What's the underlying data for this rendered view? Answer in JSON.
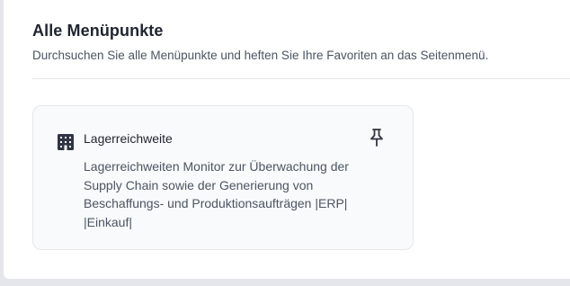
{
  "header": {
    "title": "Alle Menüpunkte",
    "subtitle": "Durchsuchen Sie alle Menüpunkte und heften Sie Ihre Favoriten an das Seitenmenü."
  },
  "cards": [
    {
      "title": "Lagerreichweite",
      "description": "Lagerreichweiten Monitor zur Überwachung der Supply Chain sowie der Generierung von Beschaffungs- und Produktionsaufträgen |ERP| |Einkauf|",
      "icon": "building-icon",
      "action_icon": "pin-icon"
    }
  ],
  "colors": {
    "background": "#e4e6eb",
    "panel": "#ffffff",
    "card_background": "#f9fafb",
    "card_border": "#e5e7eb",
    "title_text": "#1f2430",
    "body_text": "#4b5563"
  }
}
